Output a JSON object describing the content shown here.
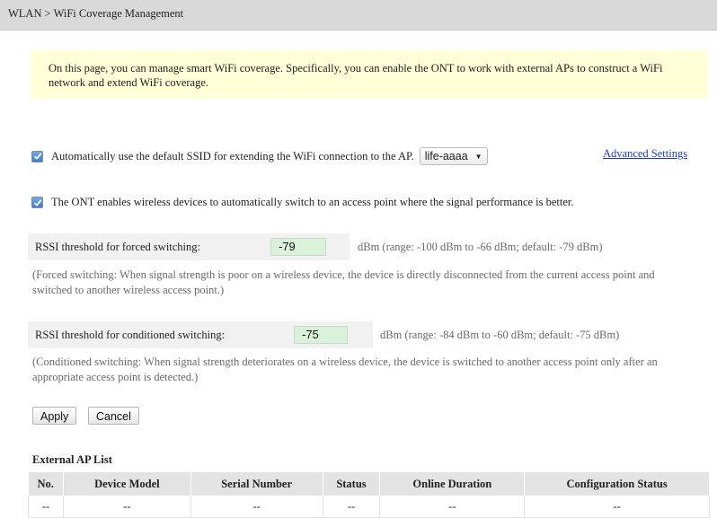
{
  "breadcrumb": {
    "section": "WLAN",
    "separator": ">",
    "page": "WiFi Coverage Management"
  },
  "info_text": "On this page, you can manage smart WiFi coverage. Specifically, you can enable the ONT to work with external APs to construct a WiFi network and extend WiFi coverage.",
  "default_ssid": {
    "checked": true,
    "label": "Automatically use the default SSID for extending the WiFi connection to the AP.",
    "ssid_value": "life-aaaa"
  },
  "advanced_settings_link": "Advanced Settings",
  "auto_switch": {
    "checked": true,
    "label": "The ONT enables wireless devices to automatically switch to an access point where the signal performance is better."
  },
  "forced": {
    "label": "RSSI threshold for forced switching:",
    "value": "-79",
    "hint": "dBm (range: -100 dBm to -66 dBm; default: -79 dBm)",
    "note": "(Forced switching: When signal strength is poor on a wireless device, the device is directly disconnected from the current access point and switched to another wireless access point.)"
  },
  "conditioned": {
    "label": "RSSI threshold for conditioned switching:",
    "value": "-75",
    "hint": "dBm (range: -84 dBm to -60 dBm; default: -75 dBm)",
    "note": "(Conditioned switching: When signal strength deteriorates on a wireless device, the device is switched to another access point only after an appropriate access point is detected.)"
  },
  "buttons": {
    "apply": "Apply",
    "cancel": "Cancel"
  },
  "ap_list": {
    "title": "External AP List",
    "headers": [
      "No.",
      "Device Model",
      "Serial Number",
      "Status",
      "Online Duration",
      "Configuration Status"
    ],
    "rows": [
      [
        "--",
        "--",
        "--",
        "--",
        "--",
        "--"
      ]
    ]
  },
  "colors": {
    "info_background": "#ffffd8",
    "input_background": "#daf1da",
    "link": "#1a3ec2",
    "header_background": "#d9d9d9"
  }
}
